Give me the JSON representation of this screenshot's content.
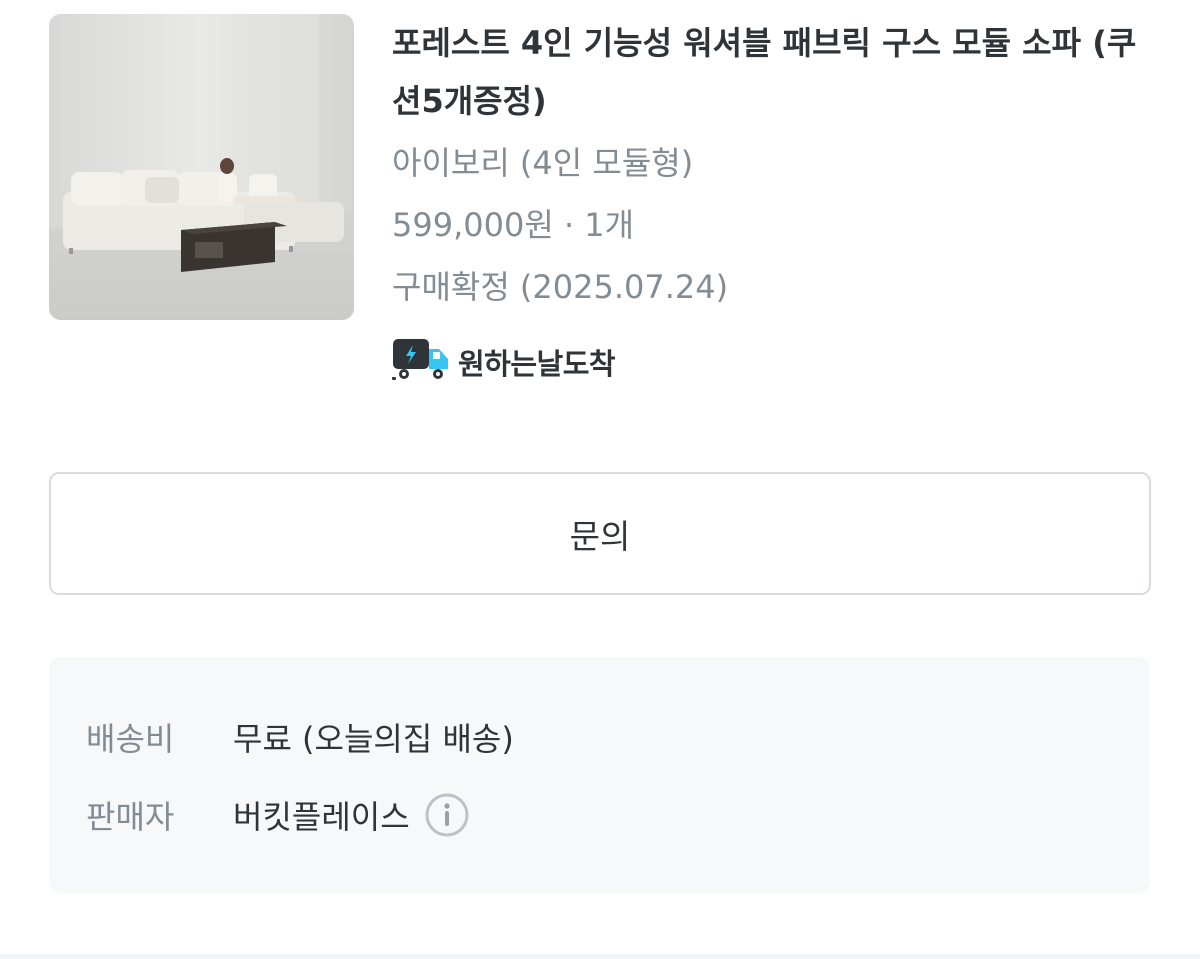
{
  "product": {
    "image_alt": "fabric modular sofa in a bright room",
    "title": "포레스트 4인 기능성 워셔블 패브릭 구스 모듈 소파 (쿠션5개증정)",
    "option": "아이보리 (4인 모듈형)",
    "price_qty": "599,000원 · 1개",
    "status": "구매확정 (2025.07.24)",
    "delivery_badge": {
      "icon": "delivery-truck-icon",
      "label": "원하는날도착",
      "color": "#35c5f0"
    }
  },
  "inquiry_button": {
    "label": "문의"
  },
  "shipping_info": {
    "rows": [
      {
        "key": "배송비",
        "value": "무료 (오늘의집 배송)"
      },
      {
        "key": "판매자",
        "value": "버킷플레이스",
        "icon": "info-circle-icon"
      }
    ]
  },
  "colors": {
    "text_primary": "#2f3438",
    "text_secondary": "#828c94",
    "panel_bg": "#f7f8fa",
    "border": "#dadde0",
    "accent": "#35c5f0"
  }
}
